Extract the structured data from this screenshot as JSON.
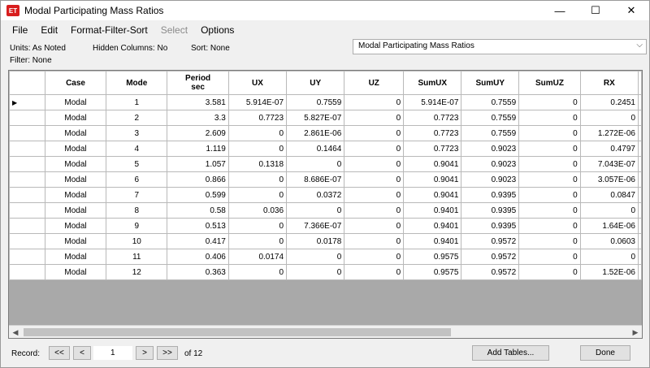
{
  "window": {
    "title": "Modal Participating Mass Ratios",
    "app_icon_text": "ET",
    "controls": [
      "—",
      "☐",
      "✕"
    ]
  },
  "menu": [
    "File",
    "Edit",
    "Format-Filter-Sort",
    "Select",
    "Options"
  ],
  "info": {
    "units": "Units:  As Noted",
    "hidden_columns": "Hidden Columns:  No",
    "sort": "Sort:  None",
    "filter": "Filter:  None"
  },
  "table_selector": {
    "value": "Modal Participating Mass Ratios"
  },
  "table": {
    "headers": [
      {
        "l1": "Case",
        "l2": ""
      },
      {
        "l1": "Mode",
        "l2": ""
      },
      {
        "l1": "Period",
        "l2": "sec"
      },
      {
        "l1": "UX",
        "l2": ""
      },
      {
        "l1": "UY",
        "l2": ""
      },
      {
        "l1": "UZ",
        "l2": ""
      },
      {
        "l1": "SumUX",
        "l2": ""
      },
      {
        "l1": "SumUY",
        "l2": ""
      },
      {
        "l1": "SumUZ",
        "l2": ""
      },
      {
        "l1": "RX",
        "l2": ""
      }
    ],
    "rows": [
      [
        "Modal",
        "1",
        "3.581",
        "5.914E-07",
        "0.7559",
        "0",
        "5.914E-07",
        "0.7559",
        "0",
        "0.2451"
      ],
      [
        "Modal",
        "2",
        "3.3",
        "0.7723",
        "5.827E-07",
        "0",
        "0.7723",
        "0.7559",
        "0",
        "0"
      ],
      [
        "Modal",
        "3",
        "2.609",
        "0",
        "2.861E-06",
        "0",
        "0.7723",
        "0.7559",
        "0",
        "1.272E-06"
      ],
      [
        "Modal",
        "4",
        "1.119",
        "0",
        "0.1464",
        "0",
        "0.7723",
        "0.9023",
        "0",
        "0.4797"
      ],
      [
        "Modal",
        "5",
        "1.057",
        "0.1318",
        "0",
        "0",
        "0.9041",
        "0.9023",
        "0",
        "7.043E-07"
      ],
      [
        "Modal",
        "6",
        "0.866",
        "0",
        "8.686E-07",
        "0",
        "0.9041",
        "0.9023",
        "0",
        "3.057E-06"
      ],
      [
        "Modal",
        "7",
        "0.599",
        "0",
        "0.0372",
        "0",
        "0.9041",
        "0.9395",
        "0",
        "0.0847"
      ],
      [
        "Modal",
        "8",
        "0.58",
        "0.036",
        "0",
        "0",
        "0.9401",
        "0.9395",
        "0",
        "0"
      ],
      [
        "Modal",
        "9",
        "0.513",
        "0",
        "7.366E-07",
        "0",
        "0.9401",
        "0.9395",
        "0",
        "1.64E-06"
      ],
      [
        "Modal",
        "10",
        "0.417",
        "0",
        "0.0178",
        "0",
        "0.9401",
        "0.9572",
        "0",
        "0.0603"
      ],
      [
        "Modal",
        "11",
        "0.406",
        "0.0174",
        "0",
        "0",
        "0.9575",
        "0.9572",
        "0",
        "0"
      ],
      [
        "Modal",
        "12",
        "0.363",
        "0",
        "0",
        "0",
        "0.9575",
        "0.9572",
        "0",
        "1.52E-06"
      ]
    ],
    "selected_row_marker": "▶"
  },
  "status": {
    "record_label": "Record:",
    "first": "<<",
    "prev": "<",
    "record_value": "1",
    "next": ">",
    "last": ">>",
    "of_total": "of 12",
    "add_tables": "Add Tables...",
    "done": "Done"
  },
  "colors": {
    "app_icon": "#d81e1e",
    "grid_empty": "#a9a9a9"
  }
}
